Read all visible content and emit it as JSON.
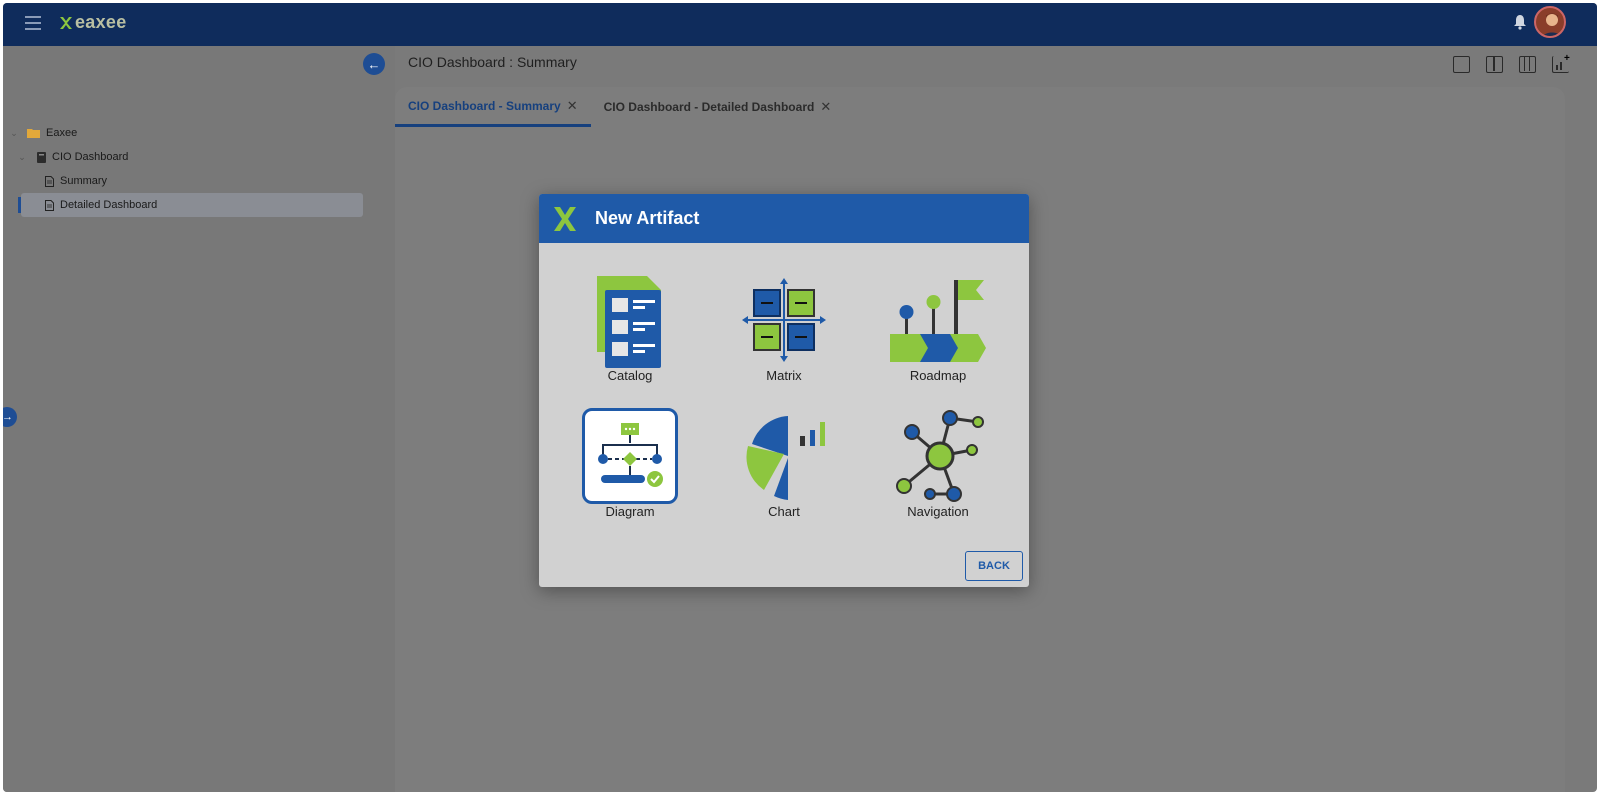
{
  "app": {
    "brand": "eaxee"
  },
  "header": {
    "title": "CIO Dashboard : Summary"
  },
  "tree": {
    "root": "Eaxee",
    "folder": "CIO Dashboard",
    "items": [
      "Summary",
      "Detailed Dashboard"
    ],
    "selected": "Detailed Dashboard"
  },
  "tabs": [
    {
      "label": "CIO Dashboard - Summary",
      "active": true
    },
    {
      "label": "CIO Dashboard - Detailed Dashboard",
      "active": false
    }
  ],
  "modal": {
    "title": "New Artifact",
    "options": [
      "Catalog",
      "Matrix",
      "Roadmap",
      "Diagram",
      "Chart",
      "Navigation"
    ],
    "selected": "Diagram",
    "back_label": "BACK"
  },
  "colors": {
    "accent": "#1f5aa8",
    "green": "#8dc63f",
    "topbar": "#0f2c5c"
  }
}
